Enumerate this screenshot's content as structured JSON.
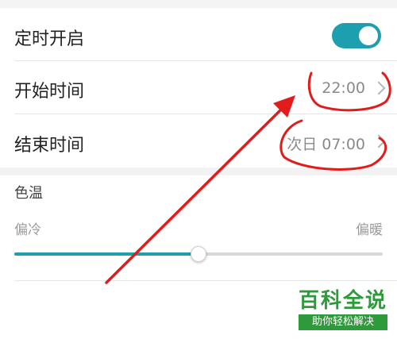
{
  "settings": {
    "timer_enable": {
      "label": "定时开启",
      "enabled": true
    },
    "start_time": {
      "label": "开始时间",
      "value": "22:00"
    },
    "end_time": {
      "label": "结束时间",
      "value": "次日 07:00"
    }
  },
  "color_temp": {
    "header": "色温",
    "left_label": "偏冷",
    "right_label": "偏暖",
    "level": 0.5
  },
  "watermark": {
    "title": "百科全说",
    "subtitle": "助你轻松解决"
  },
  "colors": {
    "accent": "#1e9fb0",
    "annotation": "#e21b1b",
    "watermark": "#2f9a3c"
  }
}
